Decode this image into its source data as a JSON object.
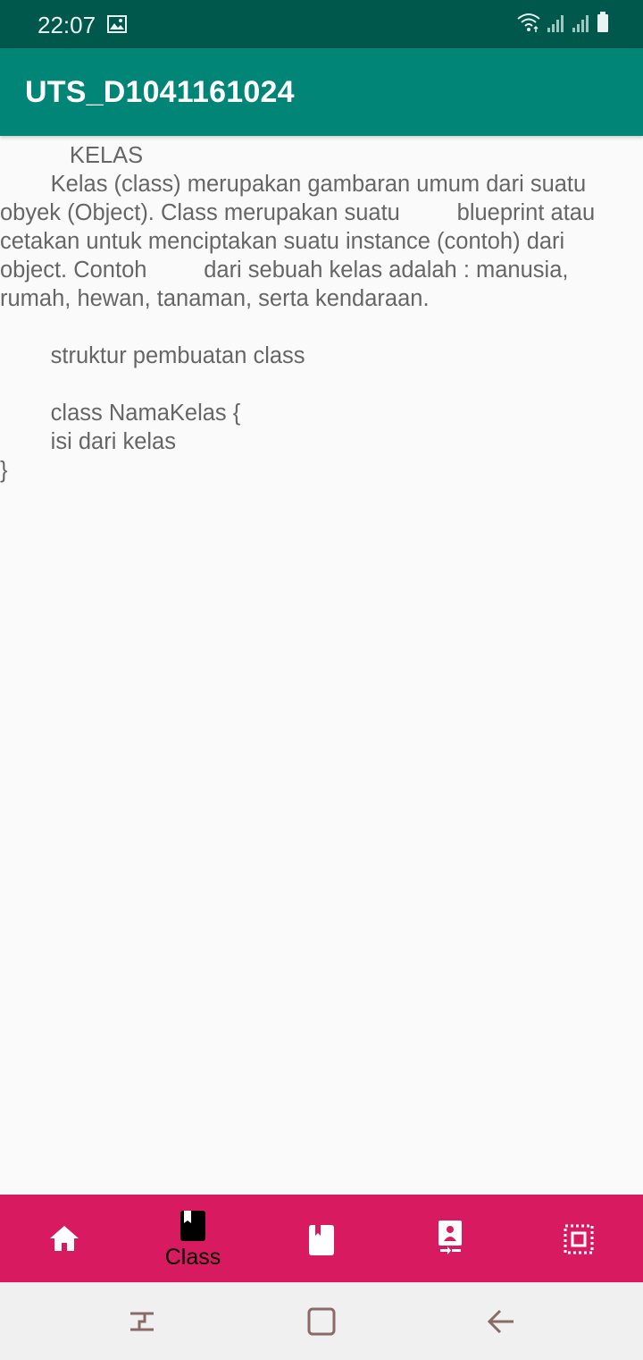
{
  "status_bar": {
    "time": "22:07",
    "icons": [
      "image-icon",
      "wifi-icon",
      "signal-icon",
      "signal-icon",
      "battery-icon"
    ]
  },
  "app_bar": {
    "title": "UTS_D1041161024",
    "color": "#008577"
  },
  "content": {
    "lines": [
      "           KELAS",
      "        Kelas (class) merupakan gambaran umum dari suatu",
      "obyek (Object). Class merupakan suatu         blueprint atau",
      "cetakan untuk menciptakan suatu instance (contoh) dari",
      "object. Contoh         dari sebuah kelas adalah : manusia,",
      "rumah, hewan, tanaman, serta kendaraan.",
      "",
      "        struktur pembuatan class",
      "",
      "        class NamaKelas {",
      "        isi dari kelas",
      "}"
    ]
  },
  "bottom_nav": {
    "color": "#d81b60",
    "items": [
      {
        "icon": "home-icon",
        "label": "",
        "active": false
      },
      {
        "icon": "book-icon",
        "label": "Class",
        "active": true
      },
      {
        "icon": "bookmark-book-icon",
        "label": "",
        "active": false
      },
      {
        "icon": "presentation-icon",
        "label": "",
        "active": false
      },
      {
        "icon": "select-all-icon",
        "label": "",
        "active": false
      }
    ]
  },
  "system_nav": {
    "icons": [
      "recent-apps-icon",
      "home-square-icon",
      "back-icon"
    ]
  }
}
